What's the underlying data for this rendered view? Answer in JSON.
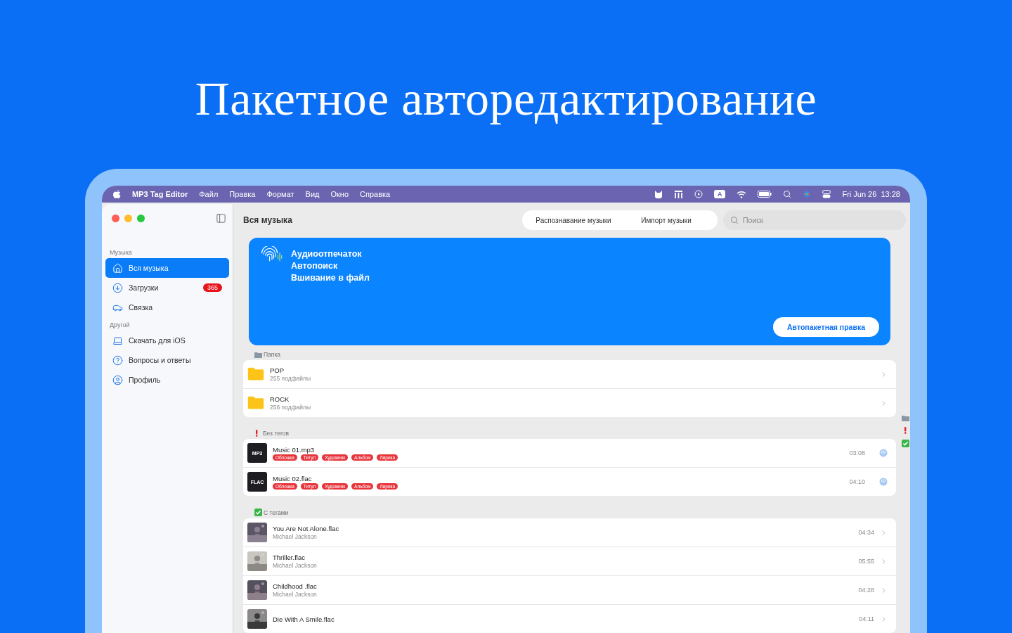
{
  "headline": "Пакетное авторедактирование",
  "menubar": {
    "app_name": "MP3 Tag Editor",
    "menus": [
      "Файл",
      "Правка",
      "Формат",
      "Вид",
      "Окно",
      "Справка"
    ],
    "input_source": "A",
    "clock": "Fri Jun 26  13:28"
  },
  "sidebar": {
    "sections": [
      {
        "title": "Музыка",
        "items": [
          {
            "label": "Вся музыка",
            "kind": "home",
            "selected": true
          },
          {
            "label": "Загрузки",
            "kind": "download",
            "selected": false,
            "badge": "365"
          },
          {
            "label": "Связка",
            "kind": "car",
            "selected": false
          }
        ]
      },
      {
        "title": "Другой",
        "items": [
          {
            "label": "Скачать для iOS",
            "kind": "devices",
            "selected": false
          },
          {
            "label": "Вопросы и ответы",
            "kind": "help",
            "selected": false
          },
          {
            "label": "Профиль",
            "kind": "user",
            "selected": false
          }
        ]
      }
    ]
  },
  "toolbar": {
    "title": "Вся музыка",
    "segments": [
      "Распознавание музыки",
      "Импорт музыки"
    ],
    "search": {
      "placeholder": "Поиск"
    }
  },
  "banner": {
    "lines": [
      "Аудиоотпечаток",
      "Автопоиск",
      "Вшивание в файл"
    ],
    "button": "Автопакетная правка"
  },
  "folders": {
    "title": "Папка",
    "items": [
      {
        "name": "POP",
        "count": "255 подфайлы"
      },
      {
        "name": "ROCK",
        "count": "256 подфайлы"
      }
    ]
  },
  "untagged": {
    "title": "Без тегов",
    "items": [
      {
        "name": "Music 01.mp3",
        "format_label": "MP3",
        "tags": [
          "Обложка",
          "Титул",
          "Художник",
          "Альбом",
          "Лирика"
        ],
        "duration": "03:08"
      },
      {
        "name": "Music 02.flac",
        "format_label": "FLAC",
        "tags": [
          "Обложка",
          "Титул",
          "Художник",
          "Альбом",
          "Лирика"
        ],
        "duration": "04:10"
      }
    ]
  },
  "tagged": {
    "title": "С тегами",
    "items": [
      {
        "name": "You Are Not Alone.flac",
        "artist": "Michael Jackson",
        "duration": "04:34"
      },
      {
        "name": "Thriller.flac",
        "artist": "Michael Jackson",
        "duration": "05:55"
      },
      {
        "name": "Childhood .flac",
        "artist": "Michael Jackson",
        "duration": "04:28"
      },
      {
        "name": "Die With A Smile.flac",
        "duration": "04:11"
      }
    ]
  }
}
